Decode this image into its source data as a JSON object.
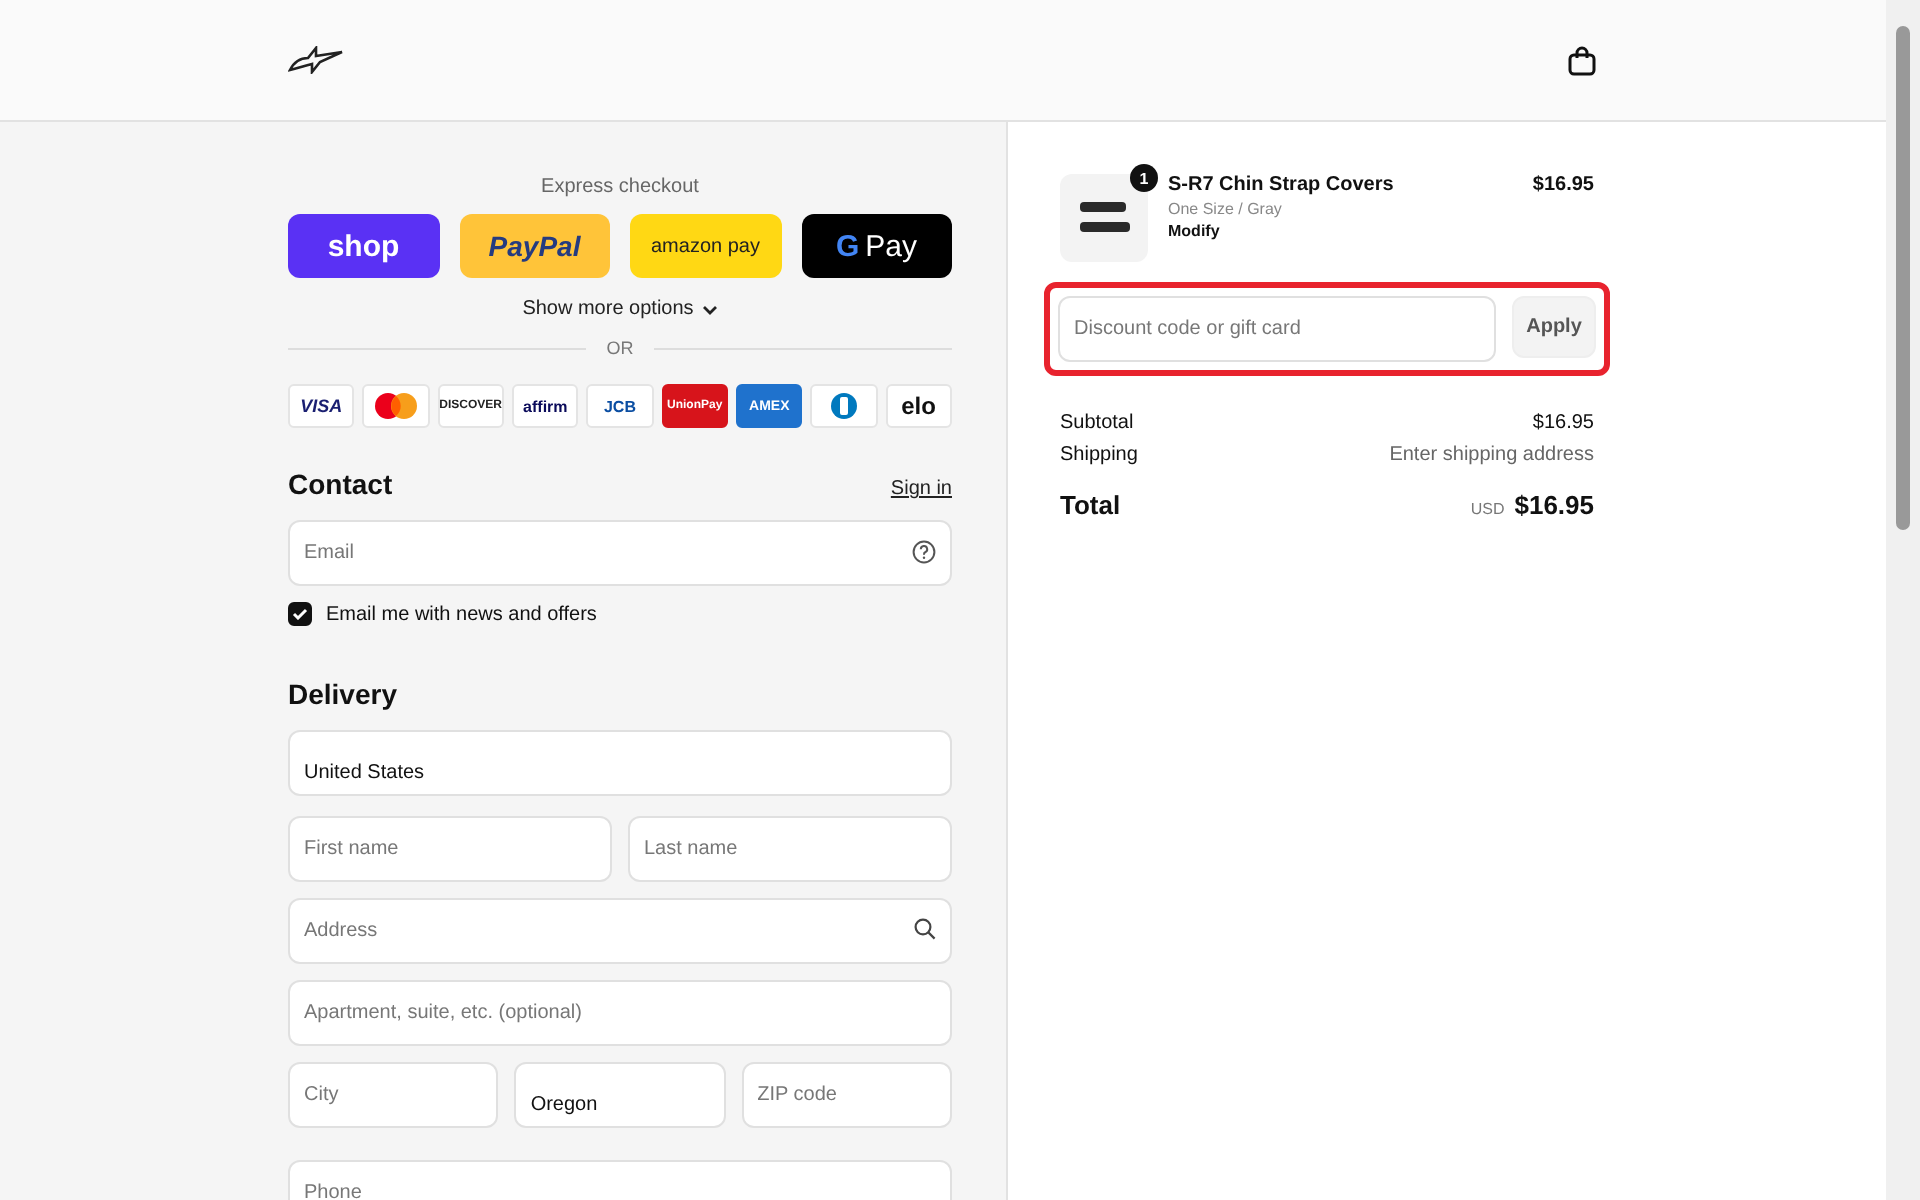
{
  "express": {
    "title": "Express checkout",
    "buttons": [
      {
        "kind": "shop",
        "label": "shop"
      },
      {
        "kind": "paypal",
        "label": "PayPal"
      },
      {
        "kind": "amazon",
        "label": "amazon pay"
      },
      {
        "kind": "gpay",
        "mark": "G",
        "label": "Pay"
      }
    ],
    "more": "Show more options",
    "or": "OR"
  },
  "cards": [
    {
      "kind": "visa",
      "label": "VISA"
    },
    {
      "kind": "mastercard"
    },
    {
      "kind": "discover",
      "label": "DISCOVER"
    },
    {
      "kind": "affirm",
      "label": "affirm"
    },
    {
      "kind": "jcb",
      "label": "JCB"
    },
    {
      "kind": "unionpay",
      "label": "UnionPay"
    },
    {
      "kind": "amex",
      "label": "AMEX"
    },
    {
      "kind": "diners"
    },
    {
      "kind": "elo",
      "label": "elo"
    }
  ],
  "contact": {
    "title": "Contact",
    "sign_in": "Sign in",
    "email": {
      "placeholder": "Email"
    },
    "newsletter": {
      "label": "Email me with news and offers",
      "checked": true
    }
  },
  "delivery": {
    "title": "Delivery",
    "country": {
      "value": "United States"
    },
    "first_name": {
      "placeholder": "First name"
    },
    "last_name": {
      "placeholder": "Last name"
    },
    "address": {
      "placeholder": "Address"
    },
    "apartment": {
      "placeholder": "Apartment, suite, etc. (optional)"
    },
    "city": {
      "placeholder": "City"
    },
    "state": {
      "value": "Oregon"
    },
    "zip": {
      "placeholder": "ZIP code"
    },
    "phone": {
      "placeholder": "Phone"
    }
  },
  "order": {
    "items": [
      {
        "name": "S-R7 Chin Strap Covers",
        "variant": "One Size / Gray",
        "action": "Modify",
        "price": "$16.95",
        "quantity": "1"
      }
    ],
    "discount": {
      "placeholder": "Discount code or gift card",
      "button": "Apply",
      "highlighted": true
    },
    "subtotal": {
      "label": "Subtotal",
      "value": "$16.95"
    },
    "shipping": {
      "label": "Shipping",
      "value": "Enter shipping address"
    },
    "total": {
      "label": "Total",
      "currency": "USD",
      "value": "$16.95"
    }
  }
}
